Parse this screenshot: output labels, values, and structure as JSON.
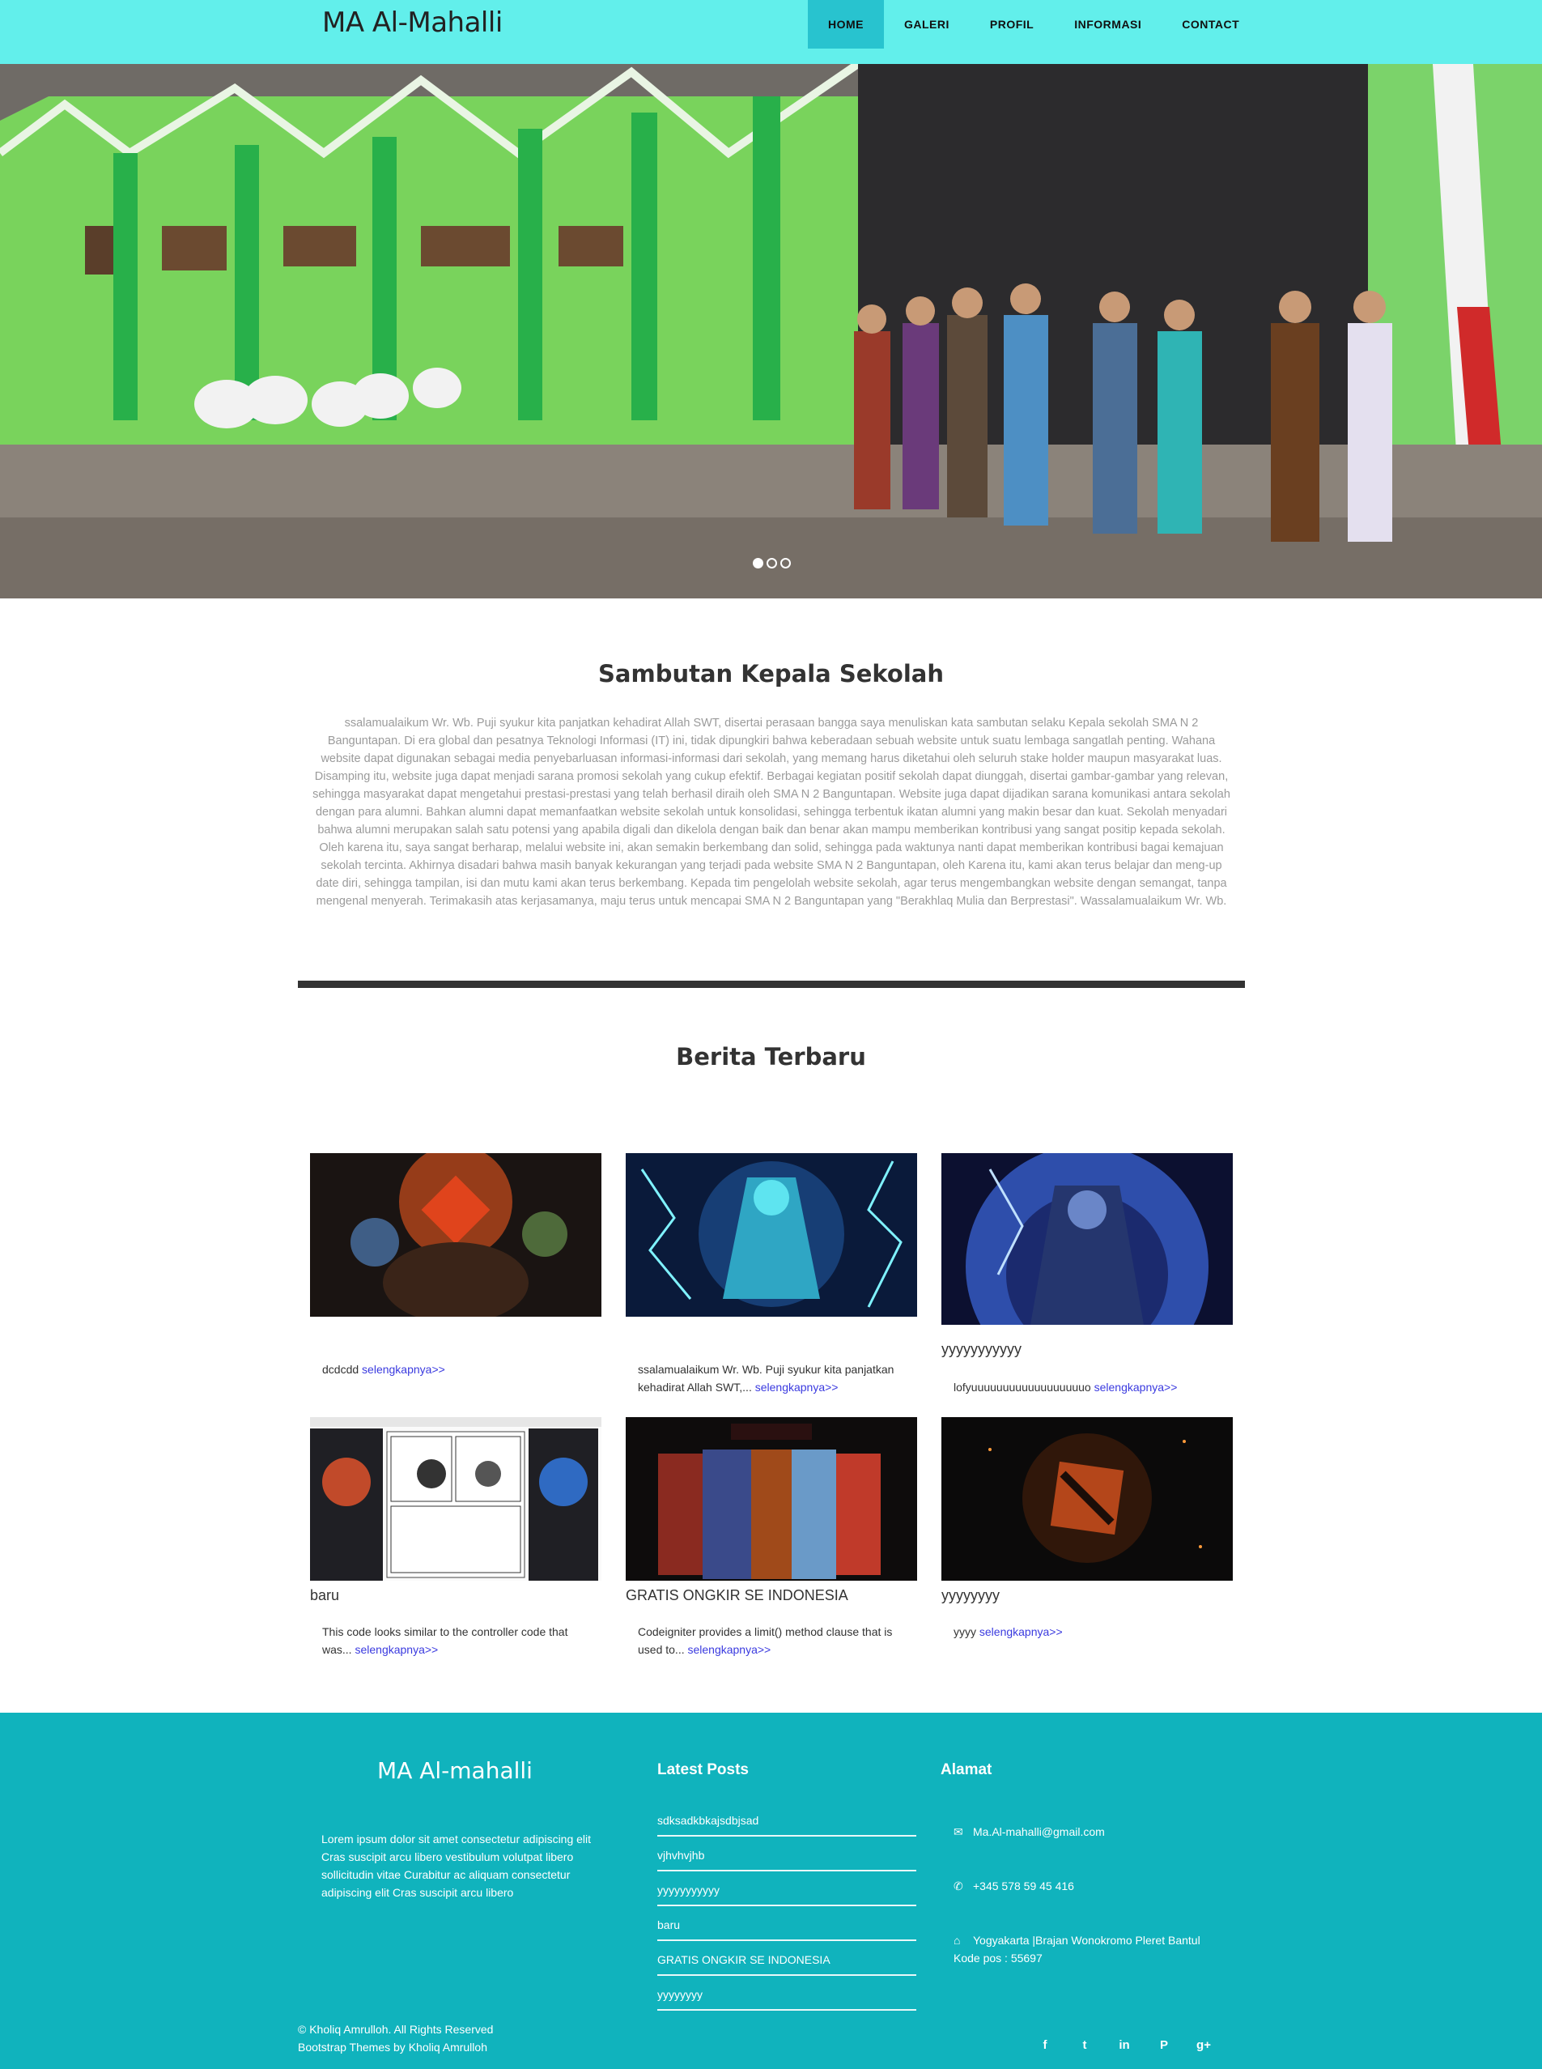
{
  "navbar": {
    "brand": "MA Al-Mahalli",
    "items": [
      {
        "label": "HOME",
        "active": true
      },
      {
        "label": "GALERI",
        "active": false
      },
      {
        "label": "PROFIL",
        "active": false
      },
      {
        "label": "INFORMASI",
        "active": false
      },
      {
        "label": "CONTACT",
        "active": false
      }
    ]
  },
  "hero": {
    "slide_count": 3,
    "active_slide": 1
  },
  "welcome": {
    "title": "Sambutan Kepala Sekolah",
    "text": "ssalamualaikum Wr. Wb. Puji syukur kita panjatkan kehadirat Allah SWT, disertai perasaan bangga saya menuliskan kata sambutan selaku Kepala sekolah SMA N 2 Banguntapan. Di era global dan pesatnya Teknologi Informasi (IT) ini, tidak dipungkiri bahwa keberadaan sebuah website untuk suatu lembaga sangatlah penting. Wahana website dapat digunakan sebagai media penyebarluasan informasi-informasi dari sekolah, yang memang harus diketahui oleh seluruh stake holder maupun masyarakat luas. Disamping itu, website juga dapat menjadi sarana promosi sekolah yang cukup efektif. Berbagai kegiatan positif sekolah dapat diunggah, disertai gambar-gambar yang relevan, sehingga masyarakat dapat mengetahui prestasi-prestasi yang telah berhasil diraih oleh SMA N 2 Banguntapan. Website juga dapat dijadikan sarana komunikasi antara sekolah dengan para alumni. Bahkan alumni dapat memanfaatkan website sekolah untuk konsolidasi, sehingga terbentuk ikatan alumni yang makin besar dan kuat. Sekolah menyadari bahwa alumni merupakan salah satu potensi yang apabila digali dan dikelola dengan baik dan benar akan mampu memberikan kontribusi yang sangat positip kepada sekolah. Oleh karena itu, saya sangat berharap, melalui website ini, akan semakin berkembang dan solid, sehingga pada waktunya nanti dapat memberikan kontribusi bagai kemajuan sekolah tercinta. Akhirnya disadari bahwa masih banyak kekurangan yang terjadi pada website SMA N 2 Banguntapan, oleh Karena itu, kami akan terus belajar dan meng-up date diri, sehingga tampilan, isi dan mutu kami akan terus berkembang. Kepada tim pengelolah website sekolah, agar terus mengembangkan website dengan semangat, tanpa mengenal menyerah. Terimakasih atas kerjasamanya, maju terus untuk mencapai SMA N 2 Banguntapan yang \"Berakhlaq Mulia dan Berprestasi\". Wassalamualaikum Wr. Wb."
  },
  "news": {
    "title": "Berita Terbaru",
    "read_more": "selengkapnya>>",
    "items": [
      {
        "title": "",
        "excerpt": "dcdcdd",
        "image": "dota-heroes-red"
      },
      {
        "title": "",
        "excerpt": "ssalamualaikum Wr. Wb. Puji syukur kita panjatkan kehadirat Allah SWT,...",
        "image": "dota-lightning-blue"
      },
      {
        "title": "yyyyyyyyyyy",
        "excerpt": "lofyuuuuuuuuuuuuuuuuuuo",
        "image": "dota-storm-blue"
      },
      {
        "title": "baru",
        "excerpt": "This code looks similar to the controller code that was...",
        "image": "manga-screenshot"
      },
      {
        "title": "GRATIS ONGKIR SE INDONESIA",
        "excerpt": "Codeigniter provides a limit() method clause that is used to...",
        "image": "dota2-heroes"
      },
      {
        "title": "yyyyyyyy",
        "excerpt": "yyyy",
        "image": "dota-logo-fire"
      }
    ]
  },
  "footer": {
    "brand": "MA Al-mahalli",
    "lorem": "Lorem ipsum dolor sit amet consectetur adipiscing elit Cras suscipit arcu libero vestibulum volutpat libero sollicitudin vitae Curabitur ac aliquam consectetur adipiscing elit Cras suscipit arcu libero",
    "latest_heading": "Latest Posts",
    "latest_posts": [
      "sdksadkbkajsdbjsad",
      "vjhvhvjhb",
      "yyyyyyyyyyy",
      "baru",
      "GRATIS ONGKIR SE INDONESIA",
      "yyyyyyyy"
    ],
    "address_heading": "Alamat",
    "email": "Ma.Al-mahalli@gmail.com",
    "phone": "+345 578 59 45 416",
    "address_line1": "Yogyakarta |Brajan Wonokromo Pleret Bantul",
    "address_line2": "Kode pos : 55697",
    "copyright": "© Kholiq Amrulloh. All Rights Reserved",
    "credit": "Bootstrap Themes by Kholiq Amrulloh",
    "social": [
      "facebook-icon",
      "twitter-icon",
      "linkedin-icon",
      "pinterest-icon",
      "google-plus-icon"
    ]
  }
}
